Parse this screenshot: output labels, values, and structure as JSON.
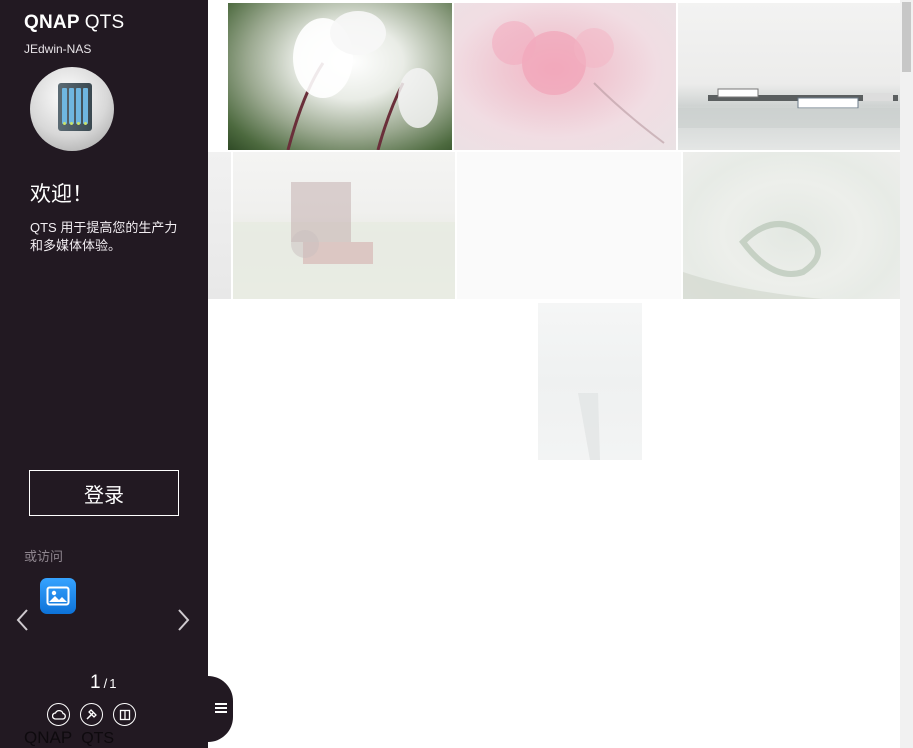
{
  "sidebar": {
    "brand_primary": "QNAP",
    "brand_secondary": "QTS",
    "host_name": "JEdwin-NAS",
    "device_icon": "nas-device-icon",
    "welcome": "欢迎！",
    "description": "QTS 用于提高您的生产力和多媒体体验。",
    "login_label": "登录",
    "or_visit": "或访问",
    "apps": [
      {
        "icon": "photo-station-icon"
      }
    ],
    "pager": {
      "current": "1",
      "separator": "/",
      "total": "1"
    },
    "bottom_icons": [
      "cloud-icon",
      "tools-icon",
      "book-icon"
    ],
    "footer_primary": "QNAP",
    "footer_secondary": "QTS"
  },
  "toggle": {
    "icon": "menu-icon"
  },
  "photos": [
    {
      "name": "white-flower-photo"
    },
    {
      "name": "pink-blossom-photo"
    },
    {
      "name": "harbor-boats-photo"
    },
    {
      "name": "partial-photo"
    },
    {
      "name": "tractor-field-photo"
    },
    {
      "name": "blank-photo"
    },
    {
      "name": "coastal-heart-photo"
    },
    {
      "name": "shoreline-photo"
    }
  ],
  "colors": {
    "sidebar_bg": "#221922",
    "app_icon": "#1a86ee",
    "page_bg": "#ffffff"
  }
}
